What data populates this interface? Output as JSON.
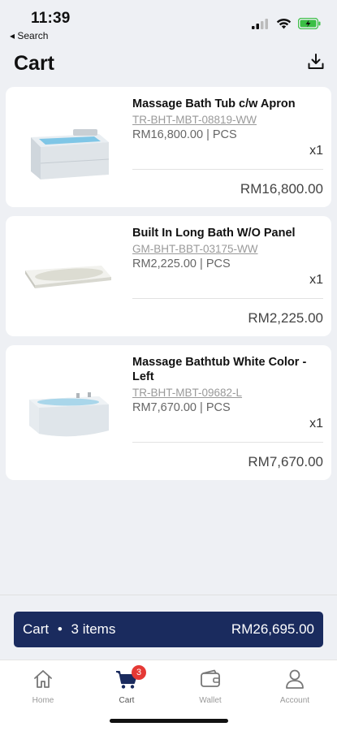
{
  "status": {
    "time": "11:39",
    "back_app": "◂ Search"
  },
  "header": {
    "title": "Cart"
  },
  "items": [
    {
      "name": "Massage Bath Tub c/w Apron",
      "code": "TR-BHT-MBT-08819-WW",
      "unit_price": "RM16,800.00 | PCS",
      "qty": "x1",
      "total": "RM16,800.00"
    },
    {
      "name": "Built In Long Bath W/O Panel",
      "code": "GM-BHT-BBT-03175-WW",
      "unit_price": "RM2,225.00 | PCS",
      "qty": "x1",
      "total": "RM2,225.00"
    },
    {
      "name": "Massage Bathtub White Color - Left",
      "code": "TR-BHT-MBT-09682-L",
      "unit_price": "RM7,670.00 | PCS",
      "qty": "x1",
      "total": "RM7,670.00"
    }
  ],
  "cart_bar": {
    "label": "Cart",
    "separator": "•",
    "count": "3 items",
    "total": "RM26,695.00"
  },
  "tabs": [
    {
      "label": "Home",
      "icon": "home-icon"
    },
    {
      "label": "Cart",
      "icon": "cart-icon",
      "badge": "3"
    },
    {
      "label": "Wallet",
      "icon": "wallet-icon"
    },
    {
      "label": "Account",
      "icon": "account-icon"
    }
  ],
  "colors": {
    "accent": "#1a2b5e",
    "badge": "#e53935",
    "battery": "#3bbf45"
  }
}
